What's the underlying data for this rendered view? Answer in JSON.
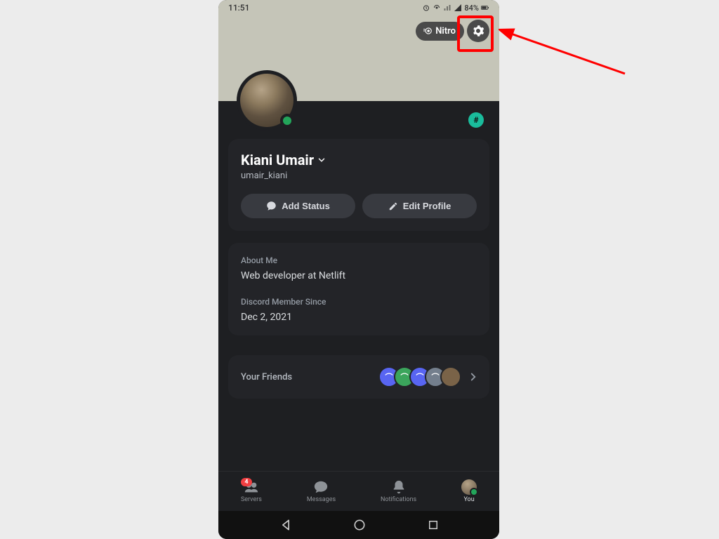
{
  "statusbar": {
    "time": "11:51",
    "battery": "84%"
  },
  "top": {
    "nitro_label": "Nitro"
  },
  "profile": {
    "display_name": "Kiani Umair",
    "username": "umair_kiani",
    "add_status_label": "Add Status",
    "edit_profile_label": "Edit Profile"
  },
  "about": {
    "about_label": "About Me",
    "about_text": "Web developer at Netlift",
    "since_label": "Discord Member Since",
    "since_text": "Dec 2, 2021"
  },
  "friends": {
    "label": "Your Friends"
  },
  "tabs": {
    "servers": "Servers",
    "servers_badge": "4",
    "messages": "Messages",
    "notifications": "Notifications",
    "you": "You"
  }
}
